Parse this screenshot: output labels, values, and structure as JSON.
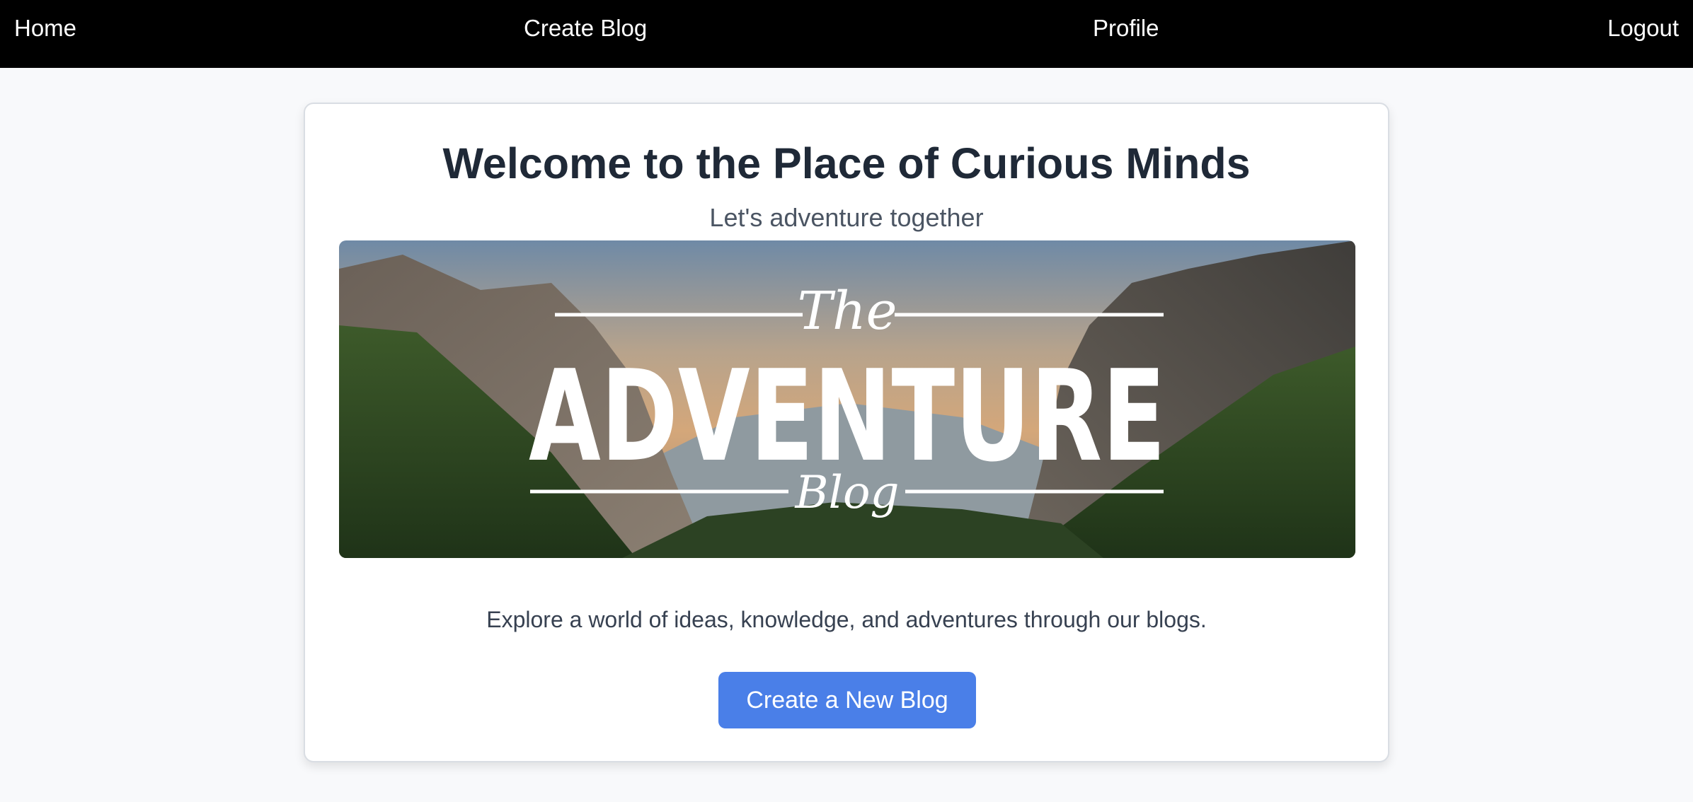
{
  "nav": {
    "home": "Home",
    "create_blog": "Create Blog",
    "profile": "Profile",
    "logout": "Logout"
  },
  "main": {
    "title": "Welcome to the Place of Curious Minds",
    "subtitle": "Let's adventure together",
    "hero_image": {
      "text_top": "The",
      "text_main": "ADVENTURE",
      "text_bottom": "Blog"
    },
    "description": "Explore a world of ideas, knowledge, and adventures through our blogs.",
    "cta_label": "Create a New Blog"
  },
  "colors": {
    "navbar": "#000000",
    "background": "#f8f9fb",
    "cta": "#4a7fe8",
    "title": "#1f2937"
  }
}
